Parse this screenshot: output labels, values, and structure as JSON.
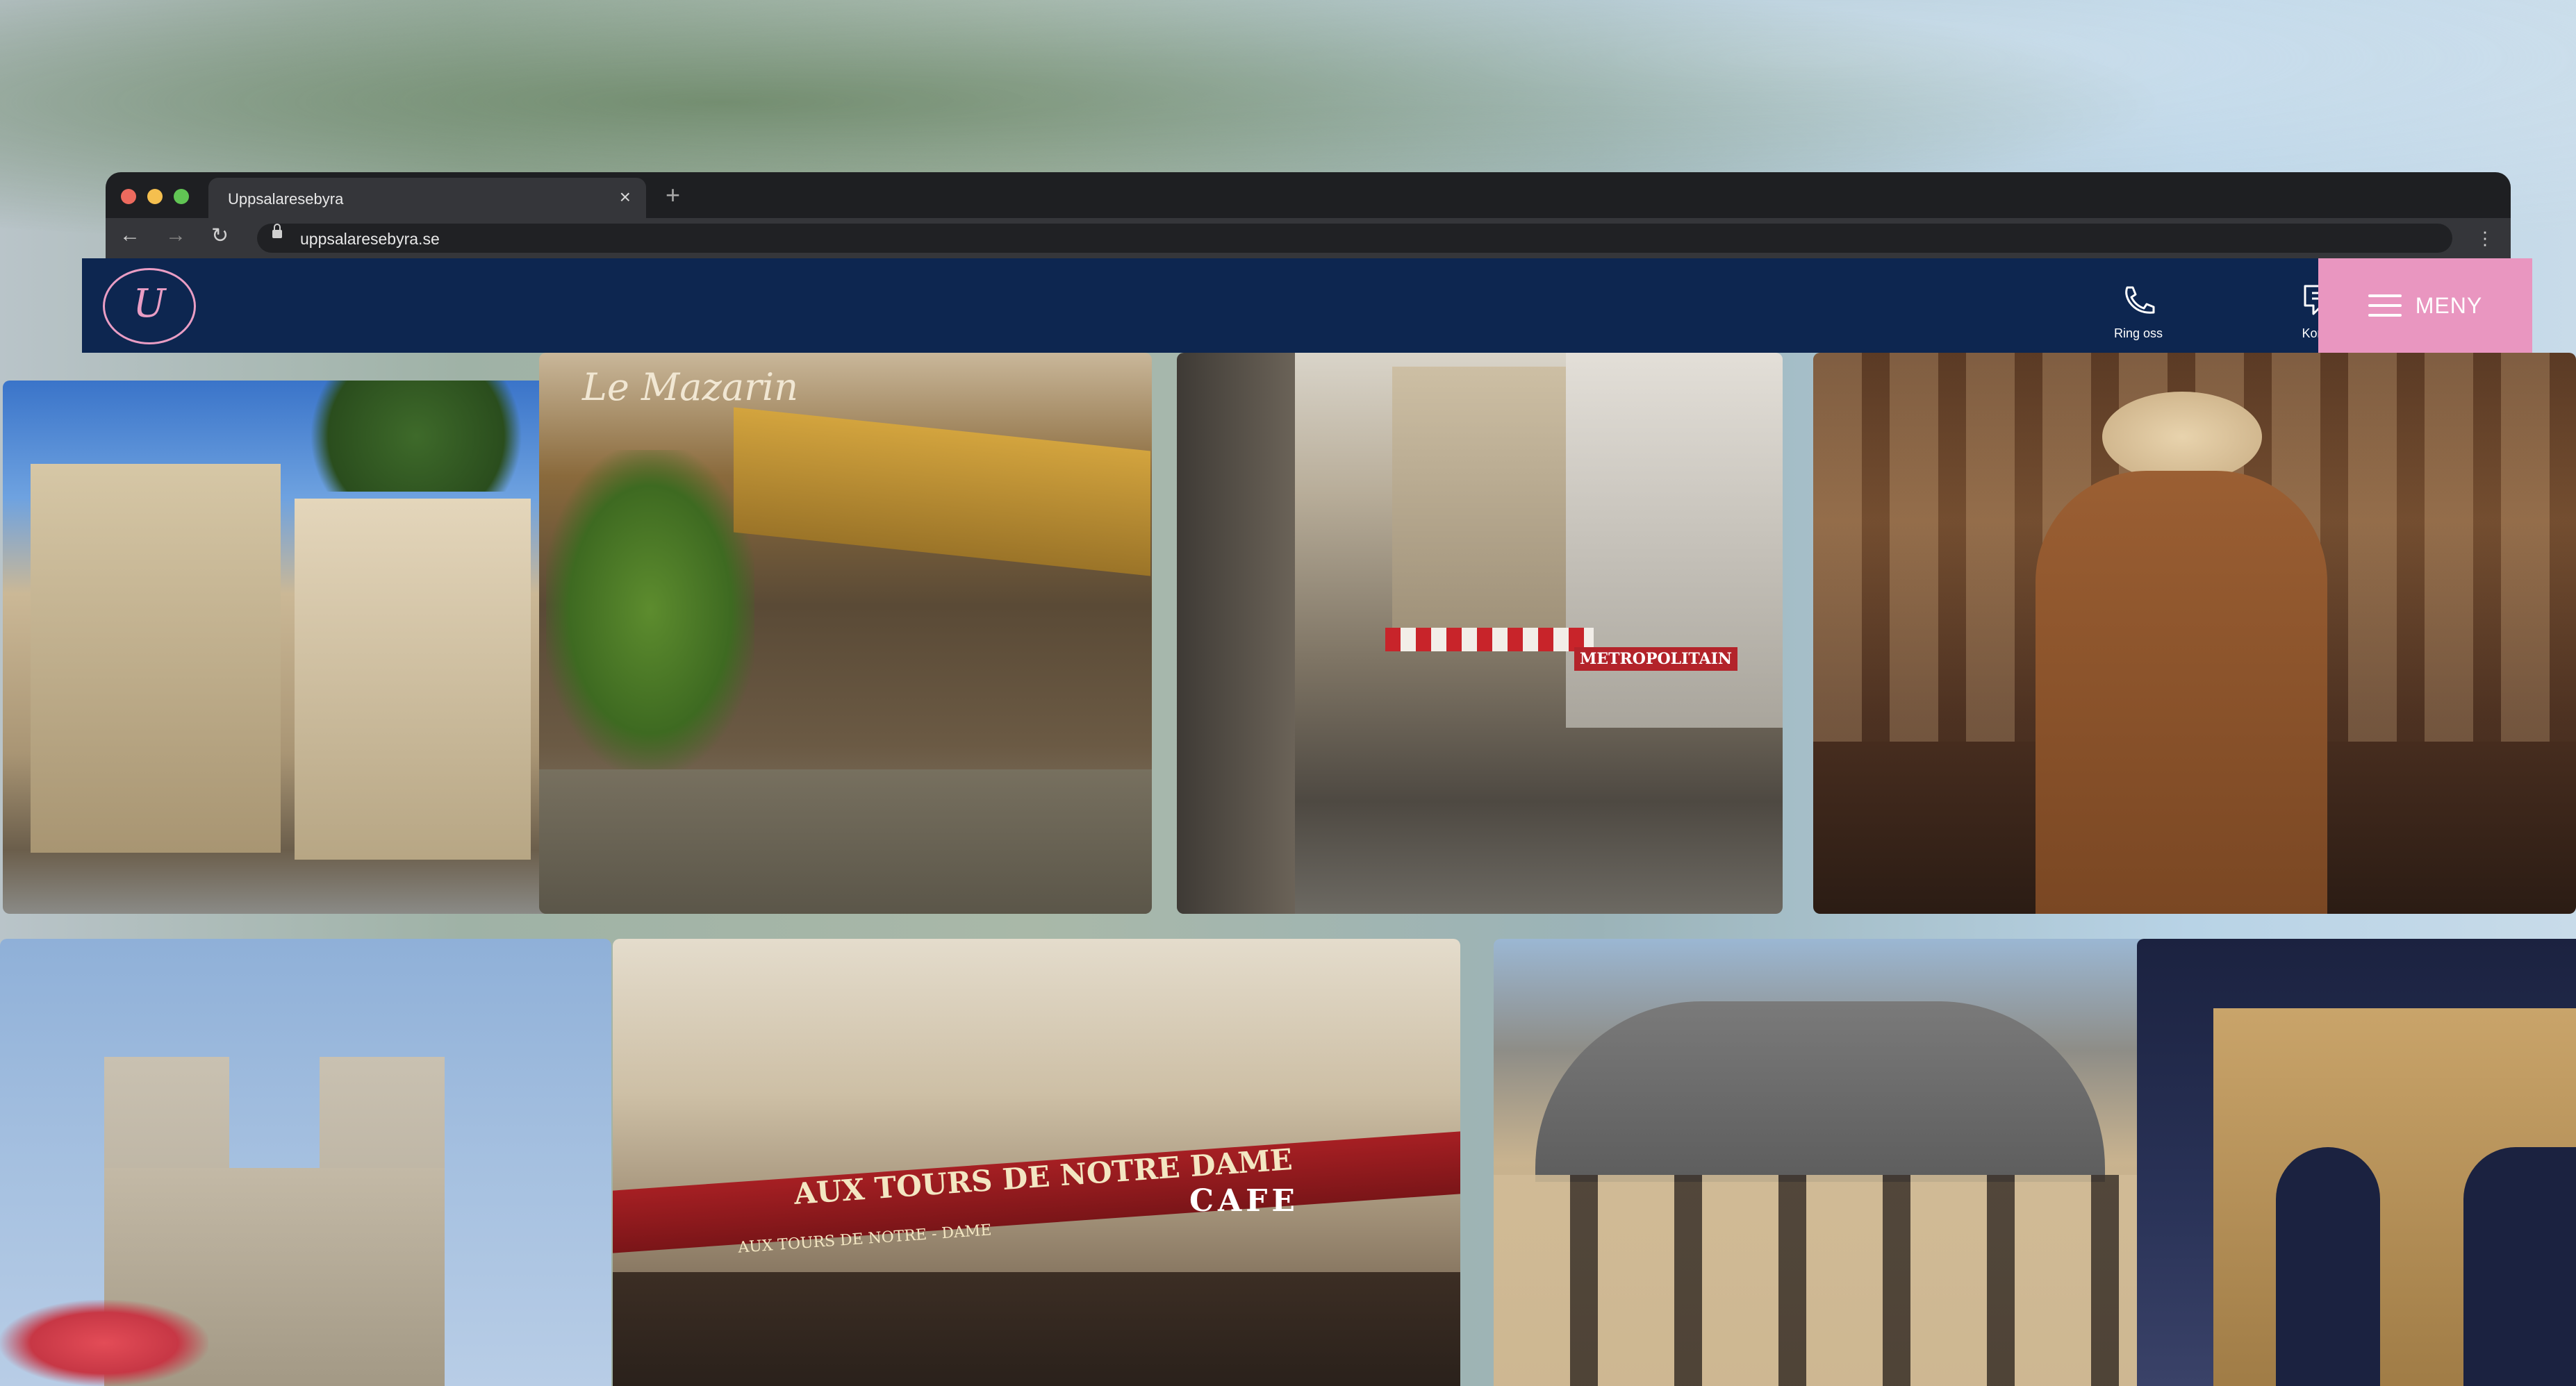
{
  "browser": {
    "tab_title": "Uppsalaresebyra",
    "tab_close": "×",
    "new_tab": "+",
    "url": "uppsalaresebyra.se",
    "back": "←",
    "forward": "→",
    "reload": "↻",
    "more": "⋮",
    "traffic_lights": [
      "#ed6a5e",
      "#f5bf4f",
      "#61c554"
    ]
  },
  "header": {
    "logo_text": "U",
    "ring_label": "Ring oss",
    "kontakt_label": "Kontakt",
    "menu_label": "MENY",
    "background_color": "#0d2650",
    "accent_color": "#e996c0"
  },
  "gallery": {
    "row1": [
      {
        "name": "paris-boulevard-photo",
        "caption": ""
      },
      {
        "name": "le-mazarin-cafe-photo",
        "caption": "Le Mazarin"
      },
      {
        "name": "metropolitain-street-photo",
        "caption": "METROPOLITAIN"
      },
      {
        "name": "bouquiniste-woman-photo",
        "caption": ""
      }
    ],
    "row2": [
      {
        "name": "notre-dame-photo",
        "caption": ""
      },
      {
        "name": "aux-tours-de-notre-dame-photo",
        "caption": "AUX TOURS DE NOTRE DAME",
        "caption2": "CAFE",
        "caption3": "AUX TOURS DE NOTRE - DAME"
      },
      {
        "name": "haussmann-building-photo",
        "caption": ""
      },
      {
        "name": "arc-de-triomphe-photo",
        "caption": ""
      }
    ]
  }
}
